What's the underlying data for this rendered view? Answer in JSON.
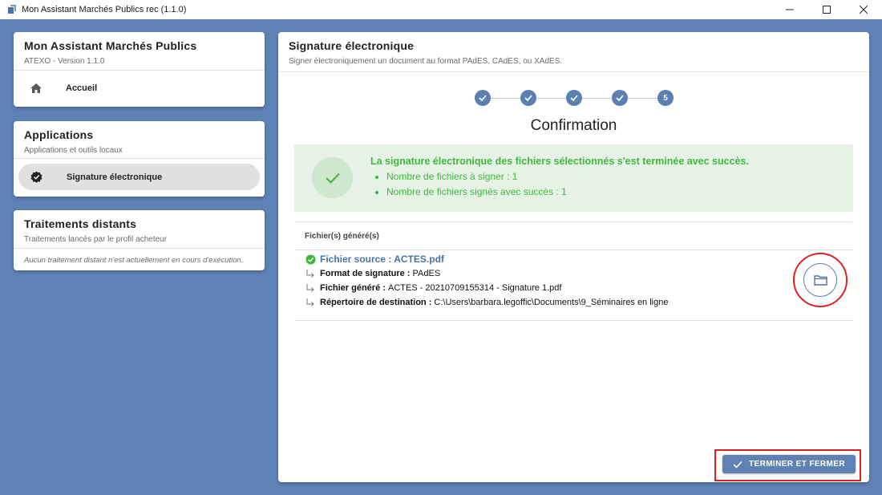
{
  "window": {
    "title": "Mon Assistant Marchés Publics rec (1.1.0)",
    "controls": [
      "minimize",
      "maximize",
      "close"
    ]
  },
  "sidebar": {
    "app_card": {
      "title": "Mon Assistant Marchés Publics",
      "subtitle": "ATEXO - Version 1.1.0",
      "items": [
        {
          "label": "Accueil",
          "icon": "home-icon"
        }
      ]
    },
    "applications_card": {
      "title": "Applications",
      "subtitle": "Applications et outils locaux",
      "items": [
        {
          "label": "Signature électronique",
          "icon": "verified-badge-icon",
          "active": true
        }
      ]
    },
    "remote_card": {
      "title": "Traitements distants",
      "subtitle": "Traitements lancés par le profil acheteur",
      "empty_text": "Aucun traitement distant n'est actuellement en cours d'exécution."
    }
  },
  "main": {
    "title": "Signature électronique",
    "subtitle": "Signer électroniquement un document au format PAdES, CAdES, ou XAdES.",
    "stepper": {
      "steps": [
        {
          "state": "done"
        },
        {
          "state": "done"
        },
        {
          "state": "done"
        },
        {
          "state": "done"
        },
        {
          "state": "current",
          "label": "5"
        }
      ],
      "step_title": "Confirmation"
    },
    "success": {
      "heading": "La signature électronique des fichiers sélectionnés s'est terminée avec succès.",
      "items": [
        "Nombre de fichiers à signer : 1",
        "Nombre de fichiers signés avec succès : 1"
      ],
      "color": "#3fb83f"
    },
    "files": {
      "header": "Fichier(s) généré(s)",
      "source_label": "Fichier source : ACTES.pdf",
      "rows": [
        {
          "label": "Format de signature :",
          "value": "PAdES"
        },
        {
          "label": "Fichier généré :",
          "value": "ACTES - 20210709155314 - Signature 1.pdf"
        },
        {
          "label": "Répertoire de destination :",
          "value": "C:\\Users\\barbara.legoffic\\Documents\\9_Séminaires en ligne"
        }
      ]
    },
    "finish_button": "TERMINER ET FERMER"
  },
  "colors": {
    "background": "#5f82b4",
    "accent": "#5a7fb0",
    "success": "#3fb83f",
    "highlight": "#e02020"
  }
}
